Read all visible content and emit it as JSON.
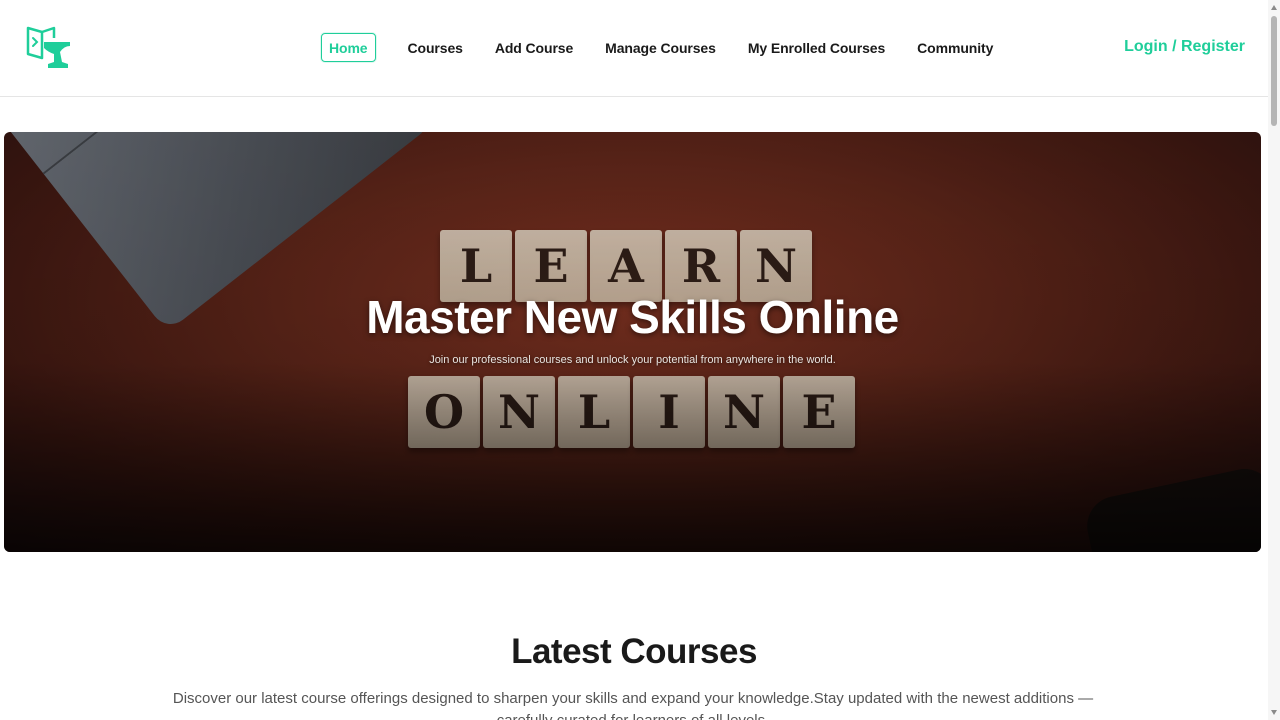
{
  "header": {
    "logo_icon": "anvil-book-icon",
    "nav": [
      {
        "label": "Home",
        "active": true
      },
      {
        "label": "Courses",
        "active": false
      },
      {
        "label": "Add Course",
        "active": false
      },
      {
        "label": "Manage Courses",
        "active": false
      },
      {
        "label": "My Enrolled Courses",
        "active": false
      },
      {
        "label": "Community",
        "active": false
      }
    ],
    "auth_label": "Login / Register"
  },
  "hero": {
    "title": "Master New Skills Online",
    "subtitle": "Join our professional courses and unlock your potential from anywhere in the world.",
    "tiles_row1": [
      "L",
      "E",
      "A",
      "R",
      "N"
    ],
    "tiles_row2": [
      "O",
      "N",
      "L",
      "I",
      "N",
      "E"
    ]
  },
  "latest": {
    "title": "Latest Courses",
    "description": "Discover our latest course offerings designed to sharpen your skills and expand your knowledge.Stay updated with the newest additions — carefully curated for learners of all levels."
  },
  "colors": {
    "accent": "#1fce9a",
    "text": "#1a1a1a"
  }
}
